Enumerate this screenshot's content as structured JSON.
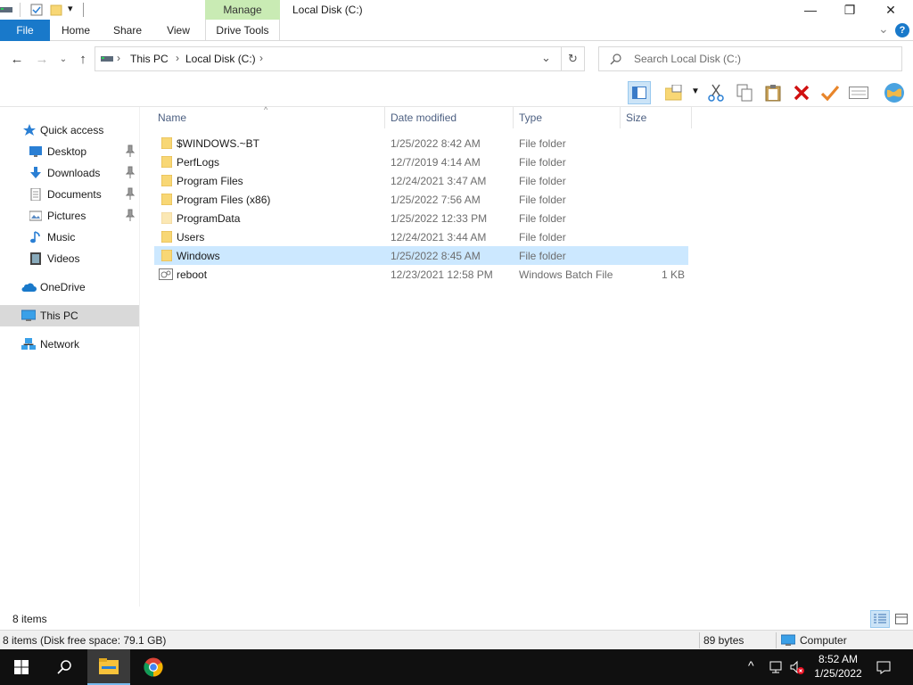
{
  "window": {
    "title": "Local Disk (C:)",
    "minimize_glyph": "—",
    "restore_glyph": "❐",
    "close_glyph": "✕"
  },
  "ribbon": {
    "tabs": [
      {
        "label": "File"
      },
      {
        "label": "Home"
      },
      {
        "label": "Share"
      },
      {
        "label": "View"
      }
    ],
    "context_group": "Manage",
    "context_tab": "Drive Tools",
    "help_glyph": "?",
    "expand_glyph": "⌄"
  },
  "address": {
    "crumbs": [
      "This PC",
      "Local Disk (C:)"
    ],
    "search_placeholder": "Search Local Disk (C:)"
  },
  "nav": {
    "items": [
      {
        "label": "Quick access",
        "icon": "star-icon"
      },
      {
        "label": "Desktop",
        "icon": "desktop-icon",
        "pinned": true
      },
      {
        "label": "Downloads",
        "icon": "download-icon",
        "pinned": true
      },
      {
        "label": "Documents",
        "icon": "documents-icon",
        "pinned": true
      },
      {
        "label": "Pictures",
        "icon": "pictures-icon",
        "pinned": true
      },
      {
        "label": "Music",
        "icon": "music-icon"
      },
      {
        "label": "Videos",
        "icon": "videos-icon"
      },
      {
        "label": "OneDrive",
        "icon": "cloud-icon"
      },
      {
        "label": "This PC",
        "icon": "computer-icon"
      },
      {
        "label": "Network",
        "icon": "network-icon"
      }
    ]
  },
  "columns": [
    "Name",
    "Date modified",
    "Type",
    "Size"
  ],
  "files": [
    {
      "name": "$WINDOWS.~BT",
      "date": "1/25/2022 8:42 AM",
      "type": "File folder",
      "size": ""
    },
    {
      "name": "PerfLogs",
      "date": "12/7/2019 4:14 AM",
      "type": "File folder",
      "size": ""
    },
    {
      "name": "Program Files",
      "date": "12/24/2021 3:47 AM",
      "type": "File folder",
      "size": ""
    },
    {
      "name": "Program Files (x86)",
      "date": "1/25/2022 7:56 AM",
      "type": "File folder",
      "size": ""
    },
    {
      "name": "ProgramData",
      "date": "1/25/2022 12:33 PM",
      "type": "File folder",
      "size": ""
    },
    {
      "name": "Users",
      "date": "12/24/2021 3:44 AM",
      "type": "File folder",
      "size": ""
    },
    {
      "name": "Windows",
      "date": "1/25/2022 8:45 AM",
      "type": "File folder",
      "size": ""
    },
    {
      "name": "reboot",
      "date": "12/23/2021 12:58 PM",
      "type": "Windows Batch File",
      "size": "1 KB"
    }
  ],
  "status": {
    "item_count": "8 items",
    "details": "8 items (Disk free space: 79.1 GB)",
    "selection_size": "89 bytes",
    "location": "Computer"
  },
  "taskbar": {
    "time": "8:52 AM",
    "date": "1/25/2022"
  },
  "colors": {
    "accent": "#1979ca",
    "selection": "#cce8ff",
    "manage_tab": "#c9ebb4",
    "folder": "#f8d775"
  }
}
